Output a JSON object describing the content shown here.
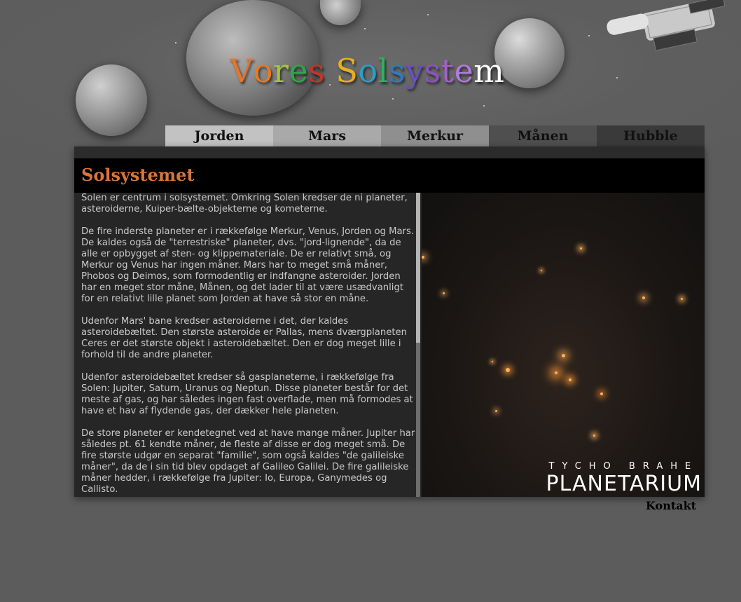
{
  "header": {
    "title_letters": [
      {
        "ch": "V",
        "color": "#e8742a"
      },
      {
        "ch": "o",
        "color": "#e87a24"
      },
      {
        "ch": "r",
        "color": "#a4c639"
      },
      {
        "ch": "e",
        "color": "#2ba84a"
      },
      {
        "ch": "s",
        "color": "#c5332b"
      },
      {
        "ch": " ",
        "color": "#ffffff"
      },
      {
        "ch": "S",
        "color": "#e8b021"
      },
      {
        "ch": "o",
        "color": "#2c9ec8"
      },
      {
        "ch": "l",
        "color": "#2eb25f"
      },
      {
        "ch": "s",
        "color": "#2a7cc4"
      },
      {
        "ch": "y",
        "color": "#6b4fc4"
      },
      {
        "ch": "s",
        "color": "#8c51c4"
      },
      {
        "ch": "t",
        "color": "#a55fd0"
      },
      {
        "ch": "e",
        "color": "#b47ae0"
      },
      {
        "ch": "m",
        "color": "#ffffff"
      }
    ]
  },
  "nav": {
    "tabs": [
      {
        "label": "Jorden"
      },
      {
        "label": "Mars"
      },
      {
        "label": "Merkur"
      },
      {
        "label": "Månen"
      },
      {
        "label": "Hubble"
      }
    ]
  },
  "main": {
    "heading": "Solsystemet",
    "paragraphs": [
      "Solen er centrum i solsystemet. Omkring Solen kredser de ni planeter, asteroiderne, Kuiper-bælte-objekterne og kometerne.",
      "De fire inderste planeter er i rækkefølge Merkur, Venus, Jorden og Mars. De kaldes også de \"terrestriske\" planeter, dvs. \"jord-lignende\", da de alle er opbygget af sten- og klippemateriale. De er relativt små, og Merkur og Venus har ingen måner. Mars har to meget små måner, Phobos og Deimos, som formodentlig er indfangne asteroider. Jorden har en meget stor måne, Månen, og det lader til at være usædvanligt for en relativt lille planet som Jorden at have så stor en måne.",
      "Udenfor Mars' bane kredser asteroiderne i det, der kaldes asteroidebæltet. Den største asteroide er Pallas, mens dværgplaneten Ceres er det største objekt i asteroidebæltet. Den er dog meget lille i forhold til de andre planeter.",
      "Udenfor asteroidebæltet kredser så gasplaneterne, i rækkefølge fra Solen: Jupiter, Saturn, Uranus og Neptun. Disse planeter består for det meste af gas, og har således ingen fast overflade, men må formodes at have et hav af flydende gas, der dækker hele planeten.",
      "De store planeter er kendetegnet ved at have mange måner. Jupiter har således pt. 61 kendte måner, de fleste af disse er dog meget små. De fire største udgør en separat \"familie\", som også kaldes \"de galileiske måner\", da de i sin tid blev opdaget af Galileo Galilei. De fire galileiske måner hedder, i rækkefølge fra Jupiter: Io, Europa, Ganymedes og Callisto."
    ],
    "image_icon": "star-cluster-photo"
  },
  "logo": {
    "top_text": "TYCHO BRAHE",
    "main_text": "PLANETARIUM"
  },
  "footer": {
    "contact_label": "Kontakt"
  },
  "colors": {
    "heading_accent": "#d9763a",
    "logo_accent": "#e23b2a"
  }
}
